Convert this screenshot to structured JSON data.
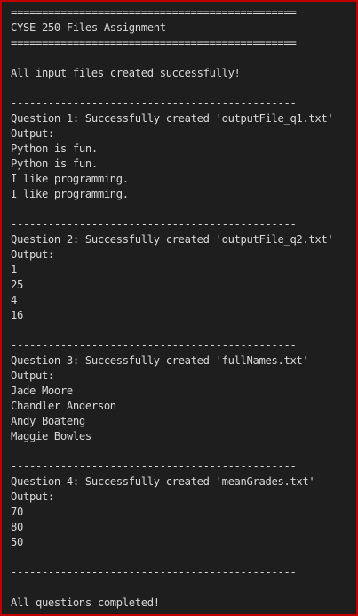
{
  "header": {
    "rule_top": "==============================================",
    "title": "CYSE 250 Files Assignment",
    "rule_bottom": "=============================================="
  },
  "intro_message": "All input files created successfully!",
  "separator": "----------------------------------------------",
  "questions": [
    {
      "status": "Question 1: Successfully created 'outputFile_q1.txt'",
      "output_label": "Output:",
      "lines": [
        "Python is fun.",
        "Python is fun.",
        "I like programming.",
        "I like programming."
      ]
    },
    {
      "status": "Question 2: Successfully created 'outputFile_q2.txt'",
      "output_label": "Output:",
      "lines": [
        "1",
        "25",
        "4",
        "16"
      ]
    },
    {
      "status": "Question 3: Successfully created 'fullNames.txt'",
      "output_label": "Output:",
      "lines": [
        "Jade Moore",
        "Chandler Anderson",
        "Andy Boateng",
        "Maggie Bowles"
      ]
    },
    {
      "status": "Question 4: Successfully created 'meanGrades.txt'",
      "output_label": "Output:",
      "lines": [
        "70",
        "80",
        "50"
      ]
    }
  ],
  "footer_separator": "----------------------------------------------",
  "completion_message": "All questions completed!",
  "colors": {
    "window_border": "#c00000",
    "console_background": "#1e1e1e",
    "console_text": "#d8d8d8"
  }
}
